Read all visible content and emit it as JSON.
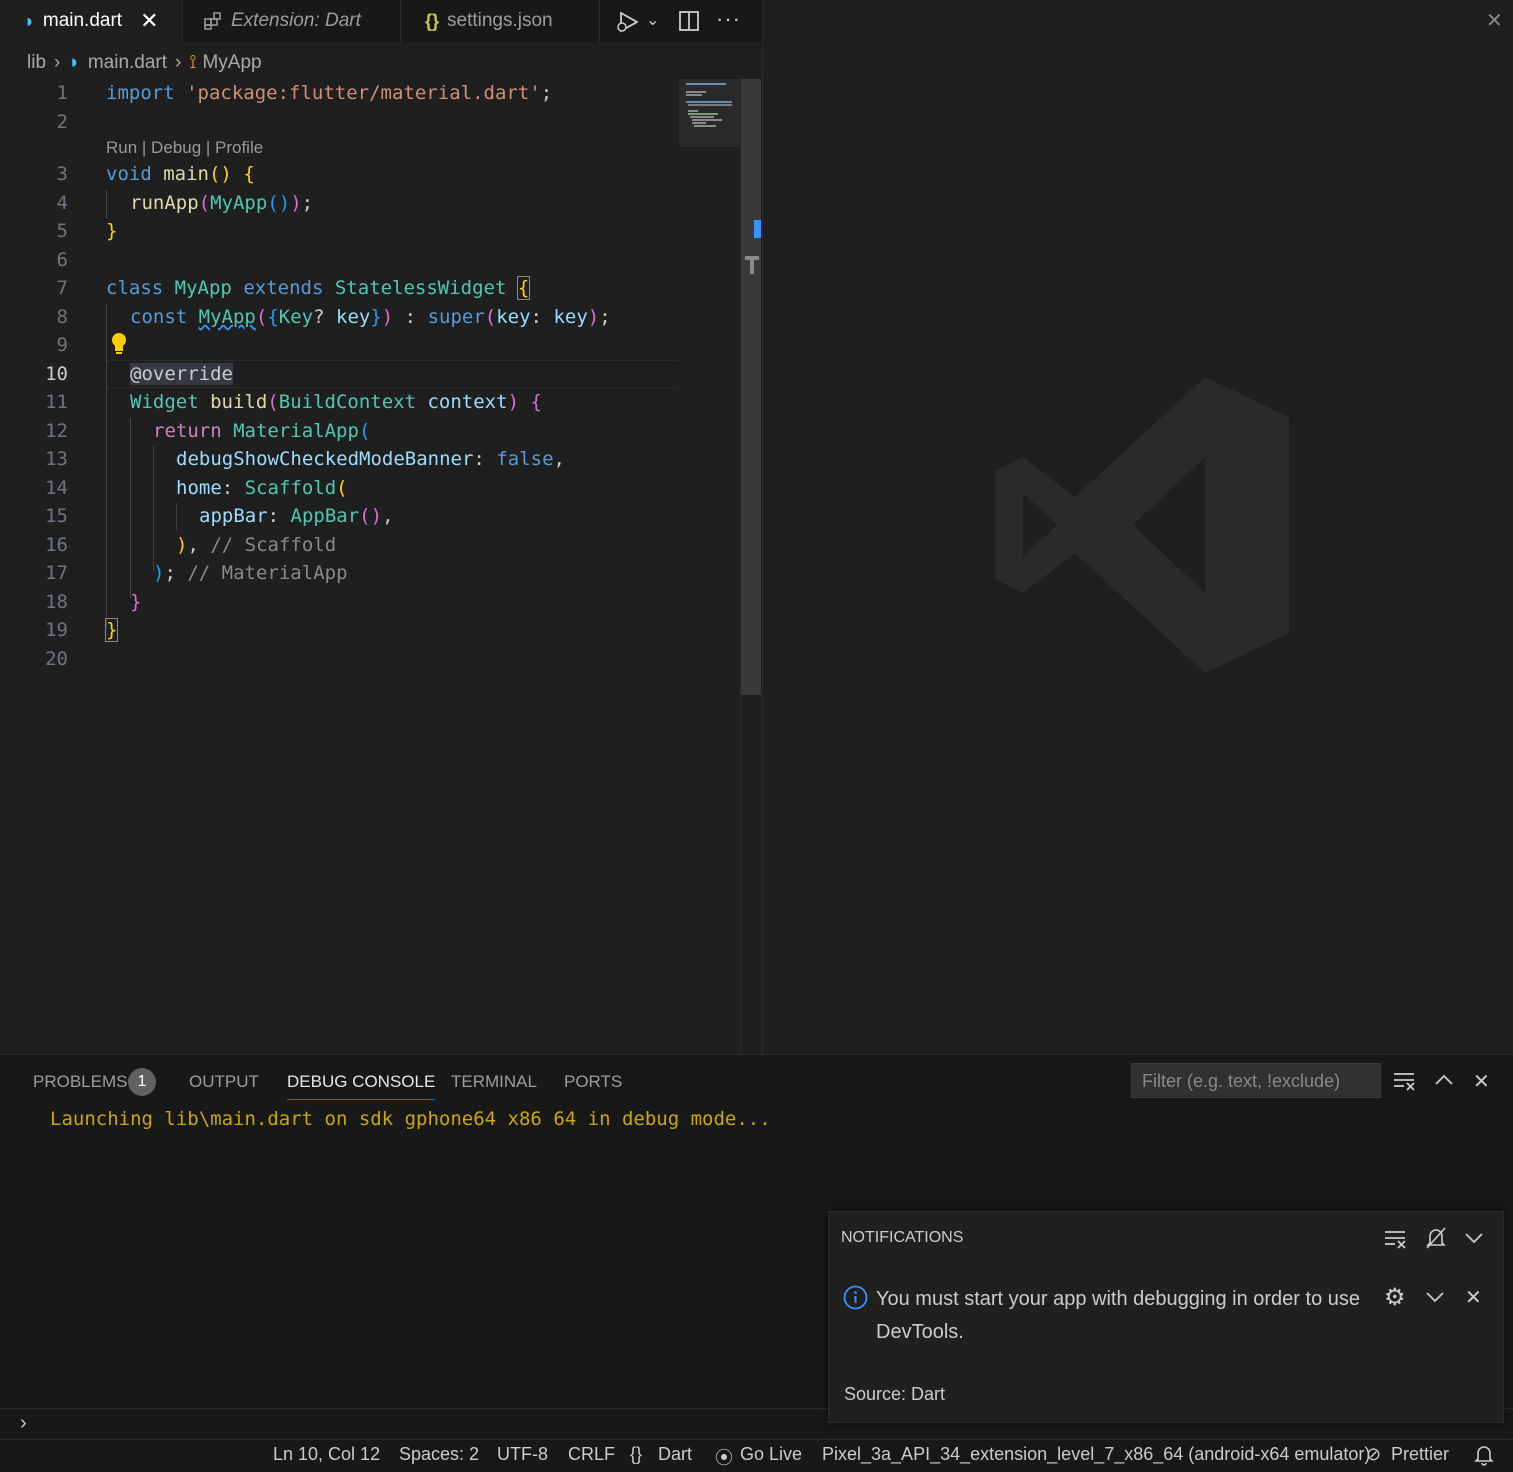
{
  "tabs": [
    {
      "label": "main.dart",
      "active": true
    },
    {
      "label": "Extension: Dart",
      "active": false
    },
    {
      "label": "settings.json",
      "active": false
    }
  ],
  "breadcrumb": {
    "folder": "lib",
    "file": "main.dart",
    "symbol": "MyApp"
  },
  "codelens": "Run | Debug | Profile",
  "line_numbers": [
    "1",
    "2",
    "3",
    "4",
    "5",
    "6",
    "7",
    "8",
    "9",
    "10",
    "11",
    "12",
    "13",
    "14",
    "15",
    "16",
    "17",
    "18",
    "19",
    "20"
  ],
  "code": {
    "l1": {
      "kw": "import",
      "str": "'package:flutter/material.dart'",
      "end": ";"
    },
    "l3": {
      "kw": "void",
      "fn": "main",
      "p": "()",
      "sp": " ",
      "b": "{"
    },
    "l4": {
      "fn": "runApp",
      "p1": "(",
      "cls": "MyApp",
      "p2": "()",
      "p3": ")",
      "end": ";"
    },
    "l5": {
      "b": "}"
    },
    "l7": {
      "kw1": "class",
      "cls": "MyApp",
      "kw2": "extends",
      "base": "StatelessWidget",
      "b": "{"
    },
    "l8": {
      "kw": "const",
      "cls": "MyApp",
      "p1": "(",
      "b1": "{",
      "typ": "Key",
      "q": "?",
      "var": "key",
      "b2": "}",
      "p2": ")",
      "colon": " : ",
      "sup": "super",
      "p3": "(",
      "named": "key",
      "c2": ": ",
      "var2": "key",
      "p4": ")",
      "end": ";"
    },
    "l10": {
      "at": "@override"
    },
    "l11": {
      "typ": "Widget",
      "fn": "build",
      "p1": "(",
      "arg": "BuildContext",
      "var": "context",
      "p2": ")",
      "b": "{"
    },
    "l12": {
      "kw": "return",
      "cls": "MaterialApp",
      "p": "("
    },
    "l13": {
      "prop": "debugShowCheckedModeBanner",
      "c": ": ",
      "val": "false",
      "end": ","
    },
    "l14": {
      "prop": "home",
      "c": ": ",
      "cls": "Scaffold",
      "p": "("
    },
    "l15": {
      "prop": "appBar",
      "c": ": ",
      "cls": "AppBar",
      "p": "()",
      "end": ","
    },
    "l16": {
      "p": ")",
      "end": ",",
      "cm": "// Scaffold"
    },
    "l17": {
      "p": ")",
      "end": ";",
      "cm": "// MaterialApp"
    },
    "l18": {
      "b": "}"
    },
    "l19": {
      "b": "}"
    }
  },
  "panel": {
    "tabs": [
      "PROBLEMS",
      "OUTPUT",
      "DEBUG CONSOLE",
      "TERMINAL",
      "PORTS"
    ],
    "problems_count": "1",
    "filter_placeholder": "Filter (e.g. text, !exclude)",
    "console_output": "Launching lib\\main.dart on sdk gphone64 x86 64 in debug mode..."
  },
  "notifications": {
    "title": "NOTIFICATIONS",
    "message": "You must start your app with debugging in order to use DevTools.",
    "source": "Source: Dart"
  },
  "statusbar": {
    "position": "Ln 10, Col 12",
    "spaces": "Spaces: 2",
    "encoding": "UTF-8",
    "eol": "CRLF",
    "language": "Dart",
    "golive": "Go Live",
    "device": "Pixel_3a_API_34_extension_level_7_x86_64 (android-x64 emulator)",
    "prettier": "Prettier"
  },
  "colors": {
    "accent": "#0078d4",
    "warning": "#cca700",
    "bg": "#1f1f1f",
    "info": "#3794ff"
  }
}
